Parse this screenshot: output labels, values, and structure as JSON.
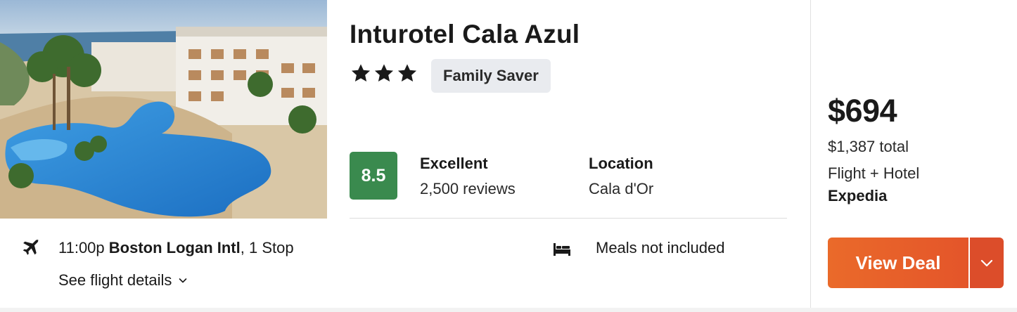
{
  "hotel": {
    "name": "Inturotel Cala Azul",
    "stars": 3,
    "badge": "Family Saver",
    "score": "8.5",
    "rating_word": "Excellent",
    "reviews": "2,500 reviews",
    "location_label": "Location",
    "location_value": "Cala d'Or"
  },
  "flight": {
    "time": "11:00p",
    "airport": "Boston Logan Intl",
    "stops": ", 1 Stop",
    "details_link": "See flight details"
  },
  "meals": "Meals not included",
  "pricing": {
    "price": "$694",
    "total": "$1,387 total",
    "package": "Flight + Hotel",
    "provider": "Expedia",
    "cta": "View Deal"
  },
  "colors": {
    "score_bg": "#3a8a4e",
    "cta": "#e85e2a",
    "badge_bg": "#e9ebef"
  },
  "icons": [
    "star-icon",
    "plane-icon",
    "chevron-down-icon",
    "bed-icon"
  ]
}
